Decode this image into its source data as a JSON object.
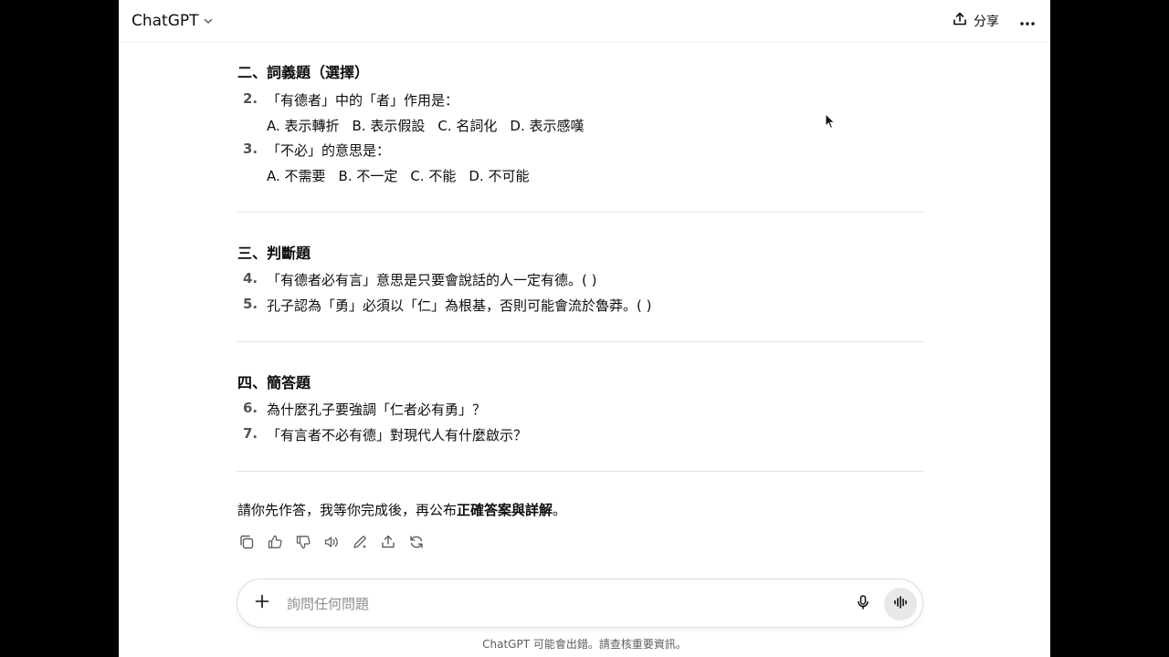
{
  "header": {
    "model_name": "ChatGPT",
    "share_label": "分享"
  },
  "sections": [
    {
      "title": "二、詞義題（選擇）",
      "questions": [
        {
          "num": "2.",
          "text": "「有德者」中的「者」作用是：",
          "options": [
            "A. 表示轉折",
            "B. 表示假設",
            "C. 名詞化",
            "D. 表示感嘆"
          ]
        },
        {
          "num": "3.",
          "text": "「不必」的意思是：",
          "options": [
            "A. 不需要",
            "B. 不一定",
            "C. 不能",
            "D. 不可能"
          ]
        }
      ]
    },
    {
      "title": "三、判斷題",
      "questions": [
        {
          "num": "4.",
          "text": "「有德者必有言」意思是只要會說話的人一定有德。( )"
        },
        {
          "num": "5.",
          "text": "孔子認為「勇」必須以「仁」為根基，否則可能會流於魯莽。( )"
        }
      ]
    },
    {
      "title": "四、簡答題",
      "questions": [
        {
          "num": "6.",
          "text": "為什麼孔子要強調「仁者必有勇」？"
        },
        {
          "num": "7.",
          "text": "「有言者不必有德」對現代人有什麼啟示？"
        }
      ]
    }
  ],
  "closing": {
    "prefix": "請你先作答，我等你完成後，再公布",
    "emphasis": "正確答案與詳解",
    "suffix": "。"
  },
  "composer": {
    "placeholder": "詢問任何問題"
  },
  "footer": {
    "disclaimer": "ChatGPT 可能會出錯。請查核重要資訊。"
  },
  "colors": {
    "page_bg": "#ffffff",
    "outer_bg": "#000000",
    "text": "#0d0d0d",
    "muted": "#5d5d5d",
    "voice_button_bg": "#e8e8e8"
  },
  "icons": [
    "chevron-down-icon",
    "share-icon",
    "more-icon",
    "copy-icon",
    "thumbs-up-icon",
    "thumbs-down-icon",
    "read-aloud-icon",
    "edit-icon",
    "share-message-icon",
    "regenerate-icon",
    "plus-icon",
    "microphone-icon",
    "voice-mode-icon"
  ]
}
